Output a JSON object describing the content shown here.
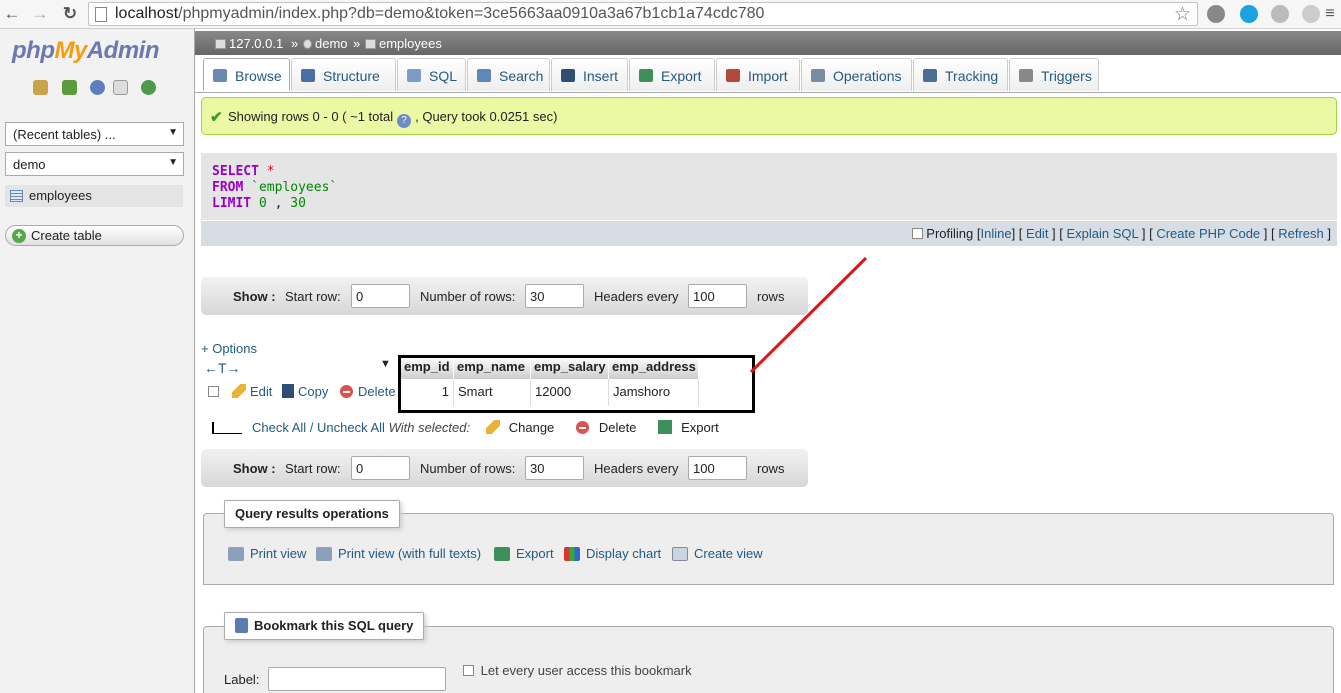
{
  "browser": {
    "url_host": "localhost",
    "url_rest": "/phpmyadmin/index.php?db=demo&token=3ce5663aa0910a3a67b1cb1a74cdc780"
  },
  "sidebar": {
    "logo_php": "php",
    "logo_my": "My",
    "logo_admin": "Admin",
    "recent_select": "(Recent tables) ...",
    "db_select": "demo",
    "table_item": "employees",
    "create_table": "Create table"
  },
  "breadcrumb": {
    "server": "127.0.0.1",
    "sep1": "»",
    "db": "demo",
    "sep2": "»",
    "table": "employees"
  },
  "tabs": [
    {
      "label": "Browse",
      "color": "#6c89b0"
    },
    {
      "label": "Structure",
      "color": "#4a6fa5"
    },
    {
      "label": "SQL",
      "color": "#7a9cc6"
    },
    {
      "label": "Search",
      "color": "#5d88b8"
    },
    {
      "label": "Insert",
      "color": "#2f4d75"
    },
    {
      "label": "Export",
      "color": "#3f8f5a"
    },
    {
      "label": "Import",
      "color": "#b5483d"
    },
    {
      "label": "Operations",
      "color": "#7a8ba4"
    },
    {
      "label": "Tracking",
      "color": "#4d6d93"
    },
    {
      "label": "Triggers",
      "color": "#888888"
    }
  ],
  "success": {
    "text1": "Showing rows 0 - 0 ( ~1 total",
    "text2": ", Query took 0.0251 sec)"
  },
  "sql": {
    "select": "SELECT",
    "star": "*",
    "from": "FROM",
    "table": "`employees`",
    "limit": "LIMIT",
    "offset": "0",
    "comma": ",",
    "count": "30"
  },
  "sql_links": {
    "profiling": "Profiling",
    "inline": "Inline",
    "edit": "Edit",
    "explain": "Explain SQL",
    "php": "Create PHP Code",
    "refresh": "Refresh"
  },
  "nav": {
    "show": "Show :",
    "start_row": "Start row:",
    "start_value": "0",
    "num_rows": "Number of rows:",
    "num_value": "30",
    "headers_every": "Headers every",
    "headers_value": "100",
    "rows": "rows"
  },
  "options_link": "+ Options",
  "table": {
    "headers": [
      "emp_id",
      "emp_name",
      "emp_salary",
      "emp_address"
    ],
    "row": [
      "1",
      "Smart",
      "12000",
      "Jamshoro"
    ],
    "edit": "Edit",
    "copy": "Copy",
    "delete": "Delete"
  },
  "with_selected": {
    "check_all": "Check All / Uncheck All",
    "label": "With selected:",
    "change": "Change",
    "delete": "Delete",
    "export": "Export"
  },
  "qro": {
    "legend": "Query results operations",
    "print": "Print view",
    "print_full": "Print view (with full texts)",
    "export": "Export",
    "chart": "Display chart",
    "view": "Create view"
  },
  "bookmark": {
    "legend": "Bookmark this SQL query",
    "label": "Label:",
    "every_user": "Let every user access this bookmark"
  }
}
